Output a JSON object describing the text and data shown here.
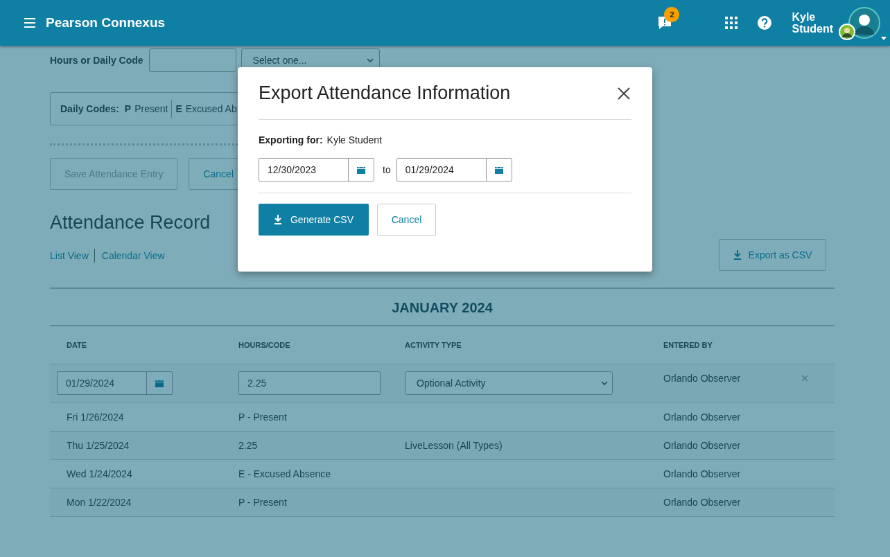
{
  "header": {
    "title": "Pearson Connexus",
    "notification_count": "2",
    "user_name": "Kyle Student"
  },
  "form": {
    "hours_label": "Hours or Daily Code",
    "select_placeholder": "Select one...",
    "daily_codes_label": "Daily Codes:",
    "codes": [
      {
        "code": "P",
        "label": "Present"
      },
      {
        "code": "E",
        "label": "Excused Ab"
      }
    ],
    "save_button": {
      "label": "Save Attendance Entry",
      "disabled": true
    },
    "cancel_button": "Cancel"
  },
  "record": {
    "title": "Attendance Record",
    "views": [
      "List View",
      "Calendar View"
    ],
    "export_button": "Export as CSV",
    "month": "JANUARY 2024",
    "columns": [
      "DATE",
      "HOURS/CODE",
      "ACTIVITY TYPE",
      "ENTERED BY"
    ],
    "edit_row": {
      "date": "01/29/2024",
      "hours": "2.25",
      "activity": "Optional Activity",
      "entered_by": "Orlando Observer"
    },
    "rows": [
      {
        "date": "Fri 1/26/2024",
        "hours": "P - Present",
        "activity": "",
        "entered_by": "Orlando Observer"
      },
      {
        "date": "Thu 1/25/2024",
        "hours": "2.25",
        "activity": "LiveLesson (All Types)",
        "entered_by": "Orlando Observer"
      },
      {
        "date": "Wed 1/24/2024",
        "hours": "E - Excused Absence",
        "activity": "",
        "entered_by": "Orlando Observer"
      },
      {
        "date": "Mon 1/22/2024",
        "hours": "P - Present",
        "activity": "",
        "entered_by": "Orlando Observer"
      }
    ]
  },
  "modal": {
    "title": "Export Attendance Information",
    "exporting_label": "Exporting for:",
    "exporting_name": "Kyle Student",
    "from_date": "12/30/2023",
    "to_label": "to",
    "to_date": "01/29/2024",
    "generate_button": "Generate CSV",
    "cancel_button": "Cancel"
  }
}
